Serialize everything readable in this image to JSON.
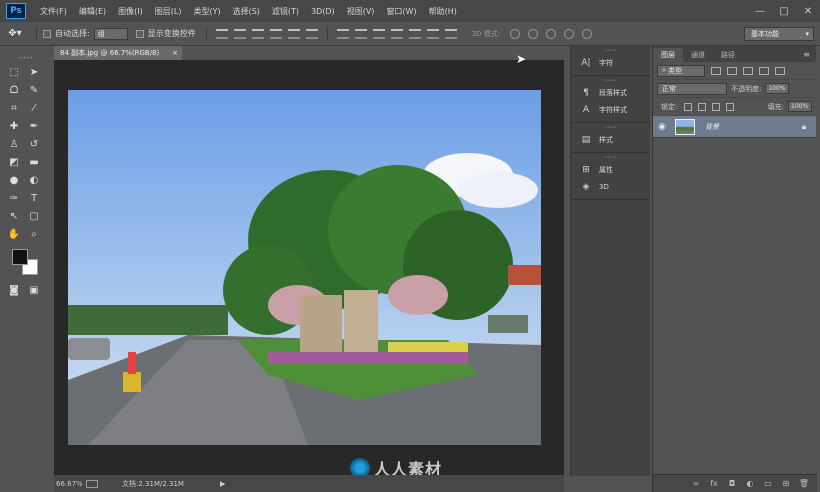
{
  "app": {
    "logo": "Ps"
  },
  "menu": [
    "文件(F)",
    "编辑(E)",
    "图像(I)",
    "图层(L)",
    "类型(Y)",
    "选择(S)",
    "滤镜(T)",
    "3D(D)",
    "视图(V)",
    "窗口(W)",
    "帮助(H)"
  ],
  "window_controls": {
    "minimize": "—",
    "maximize": "□",
    "close": "✕"
  },
  "options": {
    "auto_select_label": "自动选择:",
    "auto_select_value": "组",
    "show_transform_label": "显示变换控件",
    "mode3d_label": "3D 模式:",
    "workspace": "基本功能"
  },
  "document": {
    "tab_title": "84 副本.jpg @ 66.7%(RGB/8)",
    "tab_close": "×",
    "zoom": "66.67%",
    "doc_size": "文档:2.31M/2.31M",
    "status_arrow": "▶"
  },
  "watermark": {
    "text": "人人素材"
  },
  "dock": {
    "groups": [
      {
        "items": [
          {
            "icon": "A|",
            "label": "字符",
            "name": "character"
          }
        ]
      },
      {
        "items": [
          {
            "icon": "¶",
            "label": "段落样式",
            "name": "paragraph-styles"
          },
          {
            "icon": "A",
            "label": "字符样式",
            "name": "character-styles"
          }
        ]
      },
      {
        "items": [
          {
            "icon": "▤",
            "label": "样式",
            "name": "styles"
          }
        ]
      },
      {
        "items": [
          {
            "icon": "⊞",
            "label": "属性",
            "name": "properties"
          },
          {
            "icon": "◈",
            "label": "3D",
            "name": "3d"
          }
        ]
      }
    ]
  },
  "layers_panel": {
    "tabs": [
      "图层",
      "通道",
      "路径"
    ],
    "filter_label": "类型",
    "blend_mode": "正常",
    "opacity_label": "不透明度:",
    "opacity_value": "100%",
    "lock_label": "锁定:",
    "fill_label": "填充:",
    "fill_value": "100%",
    "layer_name": "背景"
  },
  "colors": {
    "accent": "#31a8ff",
    "selected_layer": "#6f7a8c",
    "foreground": "#111111",
    "background": "#ffffff"
  }
}
